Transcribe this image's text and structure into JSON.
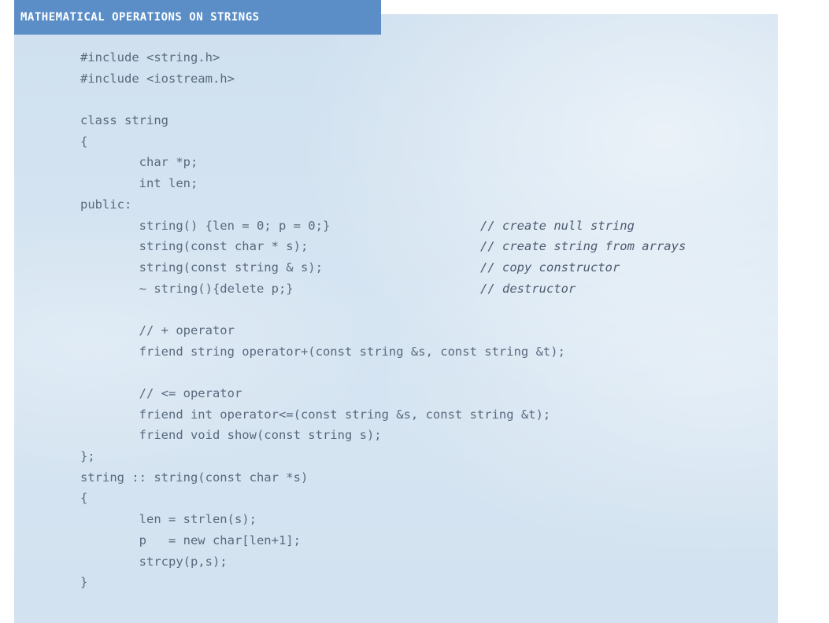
{
  "title": "MATHEMATICAL OPERATIONS ON STRINGS",
  "code_lines": [
    {
      "code": "#include <string.h>",
      "comment": ""
    },
    {
      "code": "#include <iostream.h>",
      "comment": ""
    },
    {
      "code": "",
      "comment": ""
    },
    {
      "code": "class string",
      "comment": ""
    },
    {
      "code": "{",
      "comment": ""
    },
    {
      "code": "        char *p;",
      "comment": ""
    },
    {
      "code": "        int len;",
      "comment": ""
    },
    {
      "code": "public:",
      "comment": ""
    },
    {
      "code": "        string() {len = 0; p = 0;}",
      "comment": "// create null string"
    },
    {
      "code": "        string(const char * s);",
      "comment": "// create string from arrays"
    },
    {
      "code": "        string(const string & s);",
      "comment": "// copy constructor"
    },
    {
      "code": "        ~ string(){delete p;}",
      "comment": "// destructor"
    },
    {
      "code": "",
      "comment": ""
    },
    {
      "code": "        // + operator",
      "comment": ""
    },
    {
      "code": "        friend string operator+(const string &s, const string &t);",
      "comment": ""
    },
    {
      "code": "",
      "comment": ""
    },
    {
      "code": "        // <= operator",
      "comment": ""
    },
    {
      "code": "        friend int operator<=(const string &s, const string &t);",
      "comment": ""
    },
    {
      "code": "        friend void show(const string s);",
      "comment": ""
    },
    {
      "code": "};",
      "comment": ""
    },
    {
      "code": "string :: string(const char *s)",
      "comment": ""
    },
    {
      "code": "{",
      "comment": ""
    },
    {
      "code": "        len = strlen(s);",
      "comment": ""
    },
    {
      "code": "        p   = new char[len+1];",
      "comment": ""
    },
    {
      "code": "        strcpy(p,s);",
      "comment": ""
    },
    {
      "code": "}",
      "comment": ""
    }
  ],
  "colors": {
    "banner": "#5b8ec7",
    "panel": "#d4e4f1",
    "code_text": "#5a6a7e"
  }
}
